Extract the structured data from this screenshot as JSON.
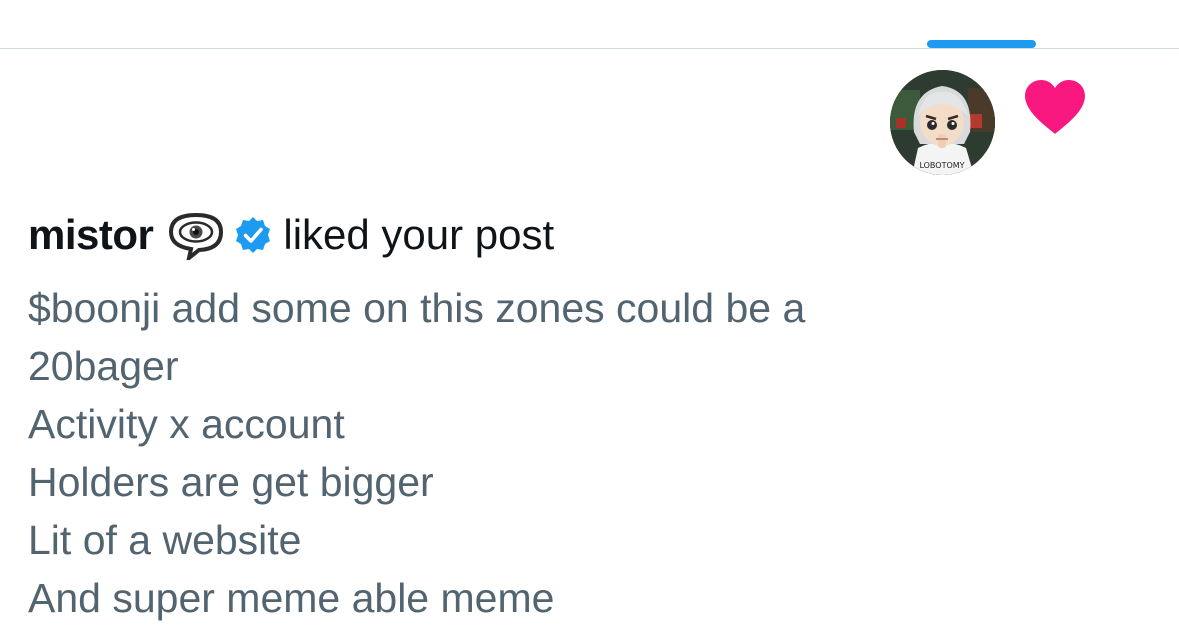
{
  "notification": {
    "user_name": "mistor",
    "action": "liked your post",
    "user_emoji": "eye-in-speech-bubble-icon",
    "verified_badge": "verified-badge-icon",
    "reaction_icon": "heart-icon"
  },
  "post": {
    "lines": [
      "$boonji add some on this zones could be a",
      "20bager",
      "Activity x account",
      "Holders are get bigger",
      "Lit of a website",
      "And super meme able meme"
    ]
  },
  "colors": {
    "tab_indicator": "#1d9bf0",
    "heart": "#f91880",
    "verified": "#1d9bf0",
    "name_text": "#0f1419",
    "body_text": "#536471",
    "divider": "#cfd9de"
  }
}
